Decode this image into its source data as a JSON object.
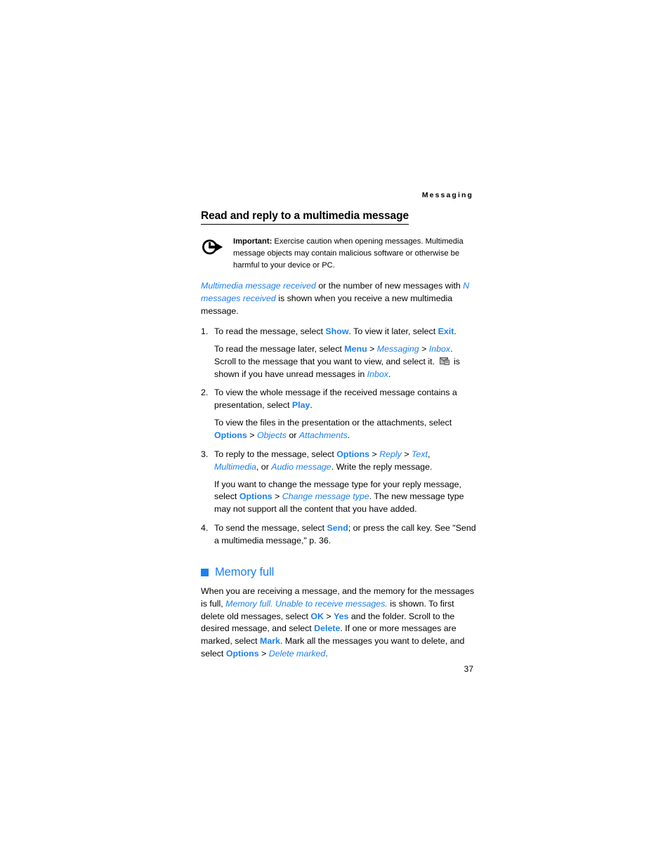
{
  "header": {
    "running_head": "Messaging"
  },
  "section": {
    "title": "Read and reply to a multimedia message"
  },
  "note": {
    "icon": "important-arrow-icon",
    "label": "Important:",
    "text": " Exercise caution when opening messages. Multimedia message objects may contain malicious software or otherwise be harmful to your device or PC."
  },
  "intro": {
    "part1": "Multimedia message received",
    "part2": " or the number of new messages with ",
    "part3": "N messages received",
    "part4": " is shown when you receive a new multimedia message."
  },
  "steps": [
    {
      "number": "1.",
      "paragraphs": [
        {
          "runs": [
            {
              "text": "To read the message, select ",
              "style": "plain"
            },
            {
              "text": "Show",
              "style": "ui-bold"
            },
            {
              "text": ". To view it later, select ",
              "style": "plain"
            },
            {
              "text": "Exit",
              "style": "ui-bold"
            },
            {
              "text": ".",
              "style": "plain"
            }
          ]
        },
        {
          "runs": [
            {
              "text": "To read the message later, select ",
              "style": "plain"
            },
            {
              "text": "Menu",
              "style": "ui-bold"
            },
            {
              "text": " > ",
              "style": "plain"
            },
            {
              "text": "Messaging",
              "style": "ui-italic"
            },
            {
              "text": " > ",
              "style": "plain"
            },
            {
              "text": "Inbox",
              "style": "ui-italic"
            },
            {
              "text": ". Scroll to the message that you want to view, and select it. ",
              "style": "plain"
            },
            {
              "text": "",
              "style": "icon",
              "icon": "unread-message-icon"
            },
            {
              "text": " is shown if you have unread messages in ",
              "style": "plain"
            },
            {
              "text": "Inbox",
              "style": "ui-italic"
            },
            {
              "text": ".",
              "style": "plain"
            }
          ]
        }
      ]
    },
    {
      "number": "2.",
      "paragraphs": [
        {
          "runs": [
            {
              "text": "To view the whole message if the received message contains a presentation, select ",
              "style": "plain"
            },
            {
              "text": "Play",
              "style": "ui-bold"
            },
            {
              "text": ".",
              "style": "plain"
            }
          ]
        },
        {
          "runs": [
            {
              "text": "To view the files in the presentation or the attachments, select ",
              "style": "plain"
            },
            {
              "text": "Options",
              "style": "ui-bold"
            },
            {
              "text": " > ",
              "style": "plain"
            },
            {
              "text": "Objects",
              "style": "ui-italic"
            },
            {
              "text": " or ",
              "style": "plain"
            },
            {
              "text": "Attachments",
              "style": "ui-italic"
            },
            {
              "text": ".",
              "style": "plain"
            }
          ]
        }
      ]
    },
    {
      "number": "3.",
      "paragraphs": [
        {
          "runs": [
            {
              "text": "To reply to the message, select ",
              "style": "plain"
            },
            {
              "text": "Options",
              "style": "ui-bold"
            },
            {
              "text": " > ",
              "style": "plain"
            },
            {
              "text": "Reply",
              "style": "ui-italic"
            },
            {
              "text": " > ",
              "style": "plain"
            },
            {
              "text": "Text",
              "style": "ui-italic"
            },
            {
              "text": ", ",
              "style": "plain"
            },
            {
              "text": "Multimedia",
              "style": "ui-italic"
            },
            {
              "text": ", or ",
              "style": "plain"
            },
            {
              "text": "Audio message",
              "style": "ui-italic"
            },
            {
              "text": ". Write the reply message.",
              "style": "plain"
            }
          ]
        },
        {
          "runs": [
            {
              "text": "If you want to change the message type for your reply message, select ",
              "style": "plain"
            },
            {
              "text": "Options",
              "style": "ui-bold"
            },
            {
              "text": " > ",
              "style": "plain"
            },
            {
              "text": "Change message type",
              "style": "ui-italic"
            },
            {
              "text": ". The new message type may not support all the content that you have added.",
              "style": "plain"
            }
          ]
        }
      ]
    },
    {
      "number": "4.",
      "paragraphs": [
        {
          "runs": [
            {
              "text": "To send the message, select ",
              "style": "plain"
            },
            {
              "text": "Send",
              "style": "ui-bold"
            },
            {
              "text": "; or press the call key. See \"Send a multimedia message,\" p. 36.",
              "style": "plain"
            }
          ]
        }
      ]
    }
  ],
  "memory_full": {
    "bullet_icon": "blue-square-bullet",
    "heading": "Memory full",
    "paragraph_runs": [
      {
        "text": "When you are receiving a message, and the memory for the messages is full, ",
        "style": "plain"
      },
      {
        "text": "Memory full. Unable to receive messages.",
        "style": "ui-italic"
      },
      {
        "text": " is shown. To first delete old messages, select ",
        "style": "plain"
      },
      {
        "text": "OK",
        "style": "ui-bold"
      },
      {
        "text": " > ",
        "style": "plain"
      },
      {
        "text": "Yes",
        "style": "ui-bold"
      },
      {
        "text": " and the folder. Scroll to the desired message, and select ",
        "style": "plain"
      },
      {
        "text": "Delete",
        "style": "ui-bold"
      },
      {
        "text": ". If one or more messages are marked, select ",
        "style": "plain"
      },
      {
        "text": "Mark",
        "style": "ui-bold"
      },
      {
        "text": ". Mark all the messages you want to delete, and select ",
        "style": "plain"
      },
      {
        "text": "Options",
        "style": "ui-bold"
      },
      {
        "text": " > ",
        "style": "plain"
      },
      {
        "text": "Delete marked",
        "style": "ui-italic"
      },
      {
        "text": ".",
        "style": "plain"
      }
    ]
  },
  "footer": {
    "page_number": "37"
  },
  "colors": {
    "accent_blue": "#1a7ff0",
    "text_black": "#000000",
    "page_background": "#ffffff"
  }
}
